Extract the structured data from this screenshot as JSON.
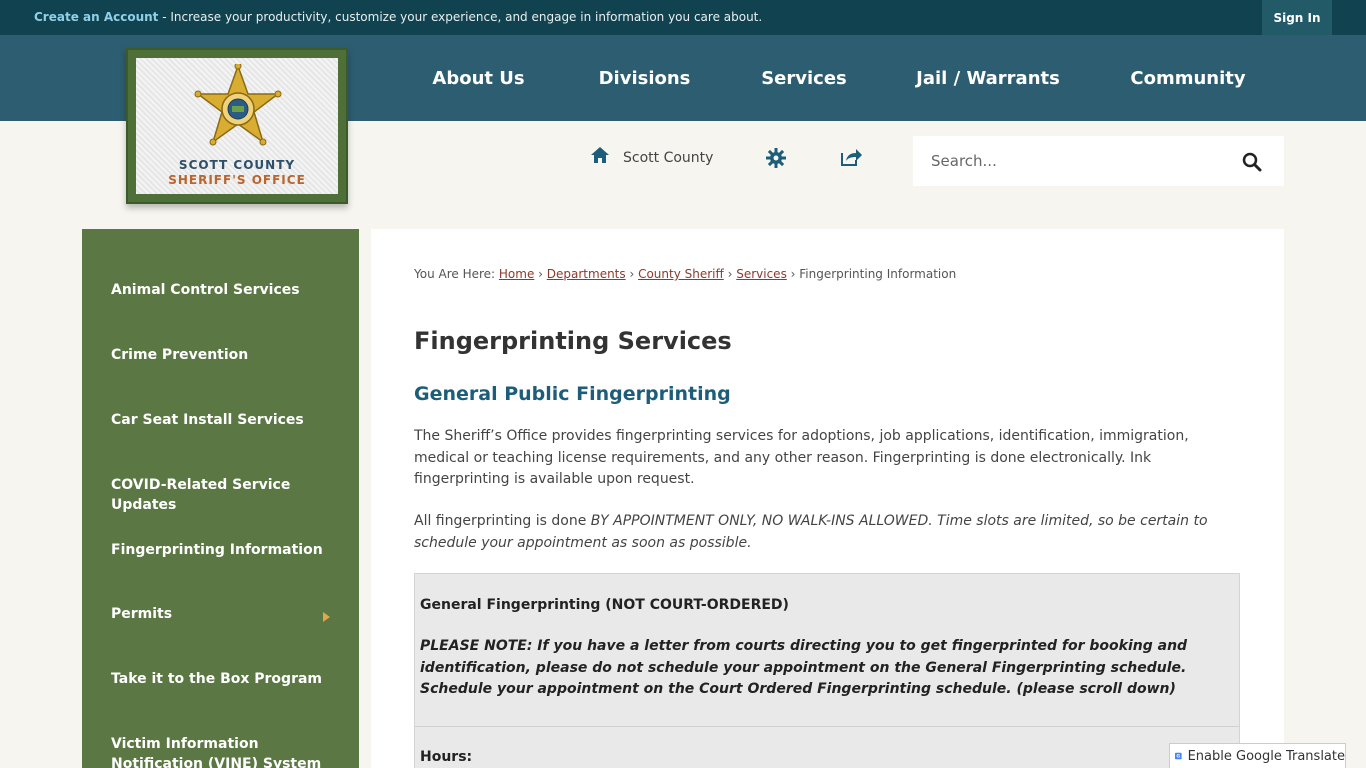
{
  "topbar": {
    "create_link": "Create an Account",
    "message": " - Increase your productivity, customize your experience, and engage in information you care about.",
    "sign_in": "Sign In"
  },
  "nav": {
    "items": [
      "About Us",
      "Divisions",
      "Services",
      "Jail / Warrants",
      "Community"
    ]
  },
  "logo": {
    "line1": "SCOTT COUNTY",
    "line2": "SHERIFF'S OFFICE",
    "star_text": "SCOTT COUNTY SHERIFF"
  },
  "utility": {
    "home_label": "Scott County",
    "icons": [
      "home-icon",
      "gear-icon",
      "share-icon"
    ]
  },
  "search": {
    "placeholder": "Search..."
  },
  "sidebar": {
    "items": [
      "Animal Control Services",
      "Crime Prevention",
      "Car Seat Install Services",
      "COVID-Related Service Updates",
      "Fingerprinting Information",
      "Permits",
      "Take it to the Box Program",
      "Victim Information Notification (VINE) System"
    ]
  },
  "breadcrumb": {
    "prefix": "You Are Here: ",
    "links": [
      "Home",
      "Departments",
      "County Sheriff",
      "Services"
    ],
    "current": "Fingerprinting Information"
  },
  "content": {
    "title": "Fingerprinting Services",
    "subtitle": "General Public Fingerprinting",
    "para1": "The Sheriff’s Office provides fingerprinting services for adoptions, job applications, identification, immigration, medical or teaching license requirements, and any other reason. Fingerprinting is done electronically. Ink fingerprinting is available upon request.",
    "para2_lead": "All fingerprinting is done ",
    "para2_italic": "BY APPOINTMENT ONLY, NO WALK-INS ALLOWED.  Time slots are limited, so be certain to schedule your appointment as soon as possible.",
    "box_heading": "General Fingerprinting (NOT COURT-ORDERED)",
    "box_note": "PLEASE NOTE:  If you have a letter from courts directing you to get fingerprinted for booking and identification, please do not schedule your appointment on the General Fingerprinting schedule.  Schedule your appointment on the Court Ordered Fingerprinting schedule.  (please scroll down)",
    "hours_label": "Hours:"
  },
  "translate": {
    "label": "Enable Google Translate"
  },
  "colors": {
    "topbar": "#10434f",
    "nav": "#2d5d70",
    "sidebar": "#5b7744",
    "accent_link": "#8b3a2b",
    "subtitle": "#1d5d7a"
  }
}
